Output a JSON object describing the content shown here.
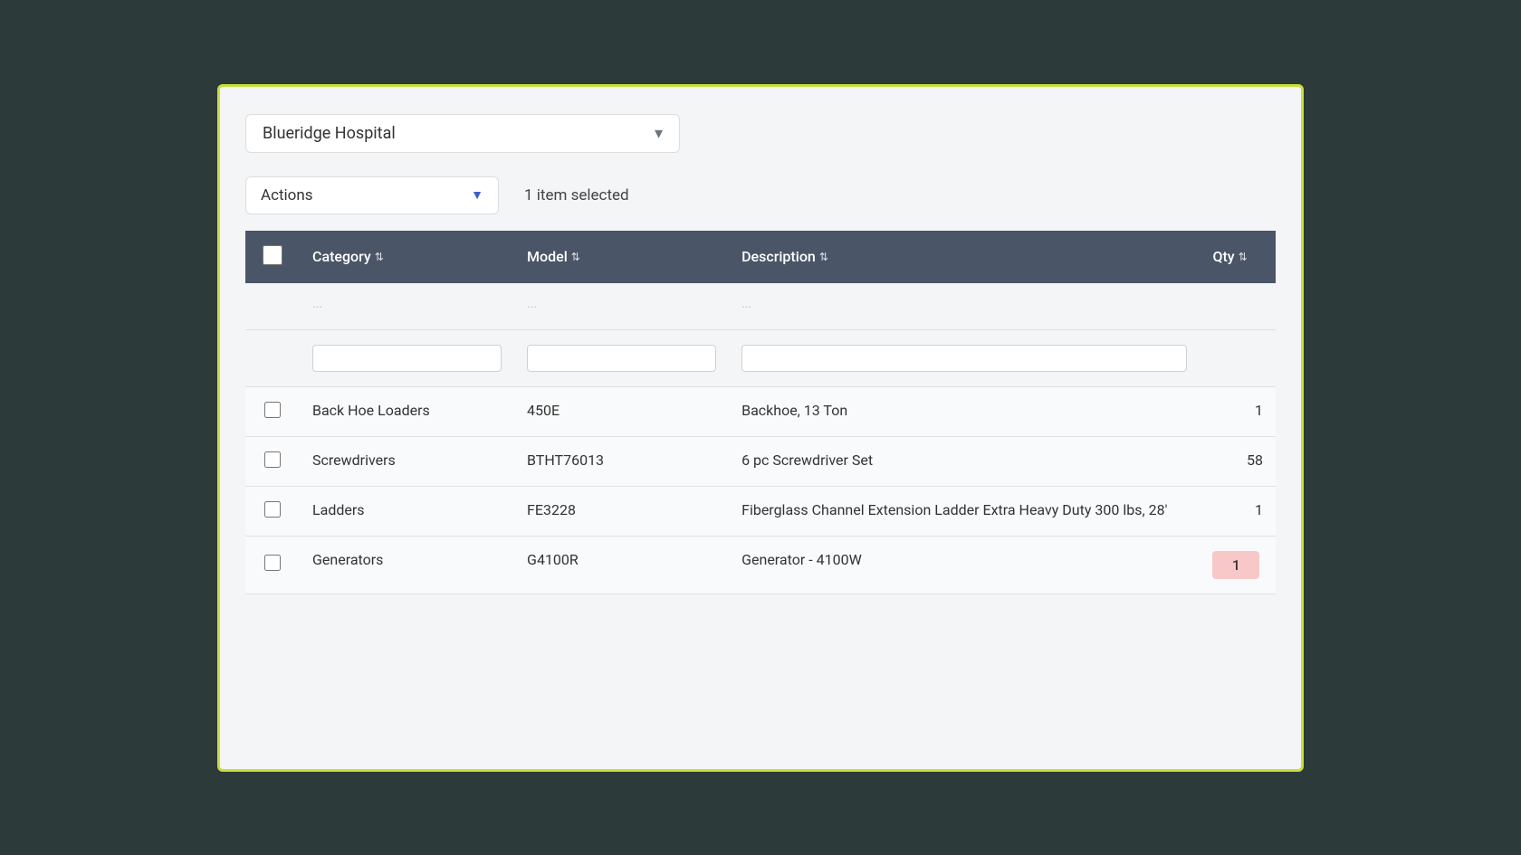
{
  "hospital": {
    "name": "Blueridge Hospital",
    "chevron": "▾"
  },
  "toolbar": {
    "actions_label": "Actions",
    "actions_arrow": "▼",
    "selection_status": "1 item selected"
  },
  "table": {
    "columns": [
      {
        "key": "checkbox",
        "label": ""
      },
      {
        "key": "category",
        "label": "Category",
        "sortable": true
      },
      {
        "key": "model",
        "label": "Model",
        "sortable": true
      },
      {
        "key": "description",
        "label": "Description",
        "sortable": true
      },
      {
        "key": "qty",
        "label": "Qty",
        "sortable": true
      }
    ],
    "rows": [
      {
        "id": 1,
        "category": "Back Hoe Loaders",
        "model": "450E",
        "description": "Backhoe, 13 Ton",
        "qty": "1",
        "qty_highlighted": false
      },
      {
        "id": 2,
        "category": "Screwdrivers",
        "model": "BTHT76013",
        "description": "6 pc Screwdriver Set",
        "qty": "58",
        "qty_highlighted": false
      },
      {
        "id": 3,
        "category": "Ladders",
        "model": "FE3228",
        "description": "Fiberglass Channel Extension Ladder Extra Heavy Duty 300 lbs, 28'",
        "qty": "1",
        "qty_highlighted": false
      },
      {
        "id": 4,
        "category": "Generators",
        "model": "G4100R",
        "description": "Generator - 4100W",
        "qty": "1",
        "qty_highlighted": true
      }
    ]
  },
  "icons": {
    "chevron_down": "▾",
    "sort": "⇅"
  }
}
